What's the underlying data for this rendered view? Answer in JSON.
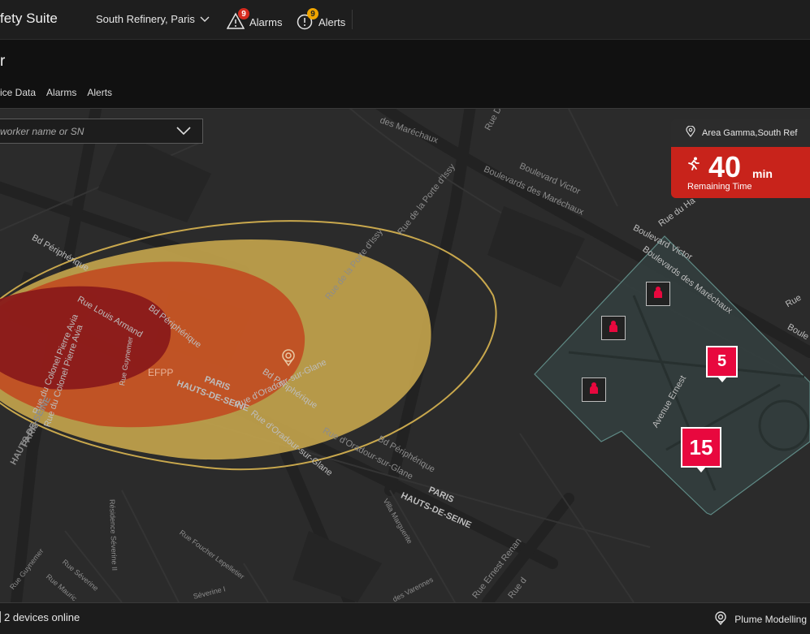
{
  "header": {
    "app_title": "fety Suite",
    "site": "South Refinery, Paris",
    "alarms": {
      "label": "Alarms",
      "count": "9",
      "badge_color": "#d62b1f"
    },
    "alerts": {
      "label": "Alerts",
      "count": "9",
      "badge_color": "#f0a500"
    }
  },
  "subheader": {
    "title": "r",
    "tabs": [
      {
        "label": "ice Data"
      },
      {
        "label": "Alarms"
      },
      {
        "label": "Alerts"
      }
    ]
  },
  "map": {
    "search_placeholder": "worker name or SN",
    "area": {
      "name": "Area Gamma,South Ref",
      "timer_value": "40",
      "timer_unit": "min",
      "timer_label": "Remaining Time",
      "timer_color": "#c8231b"
    },
    "markers": [
      {
        "count": "5"
      },
      {
        "count": "15"
      }
    ],
    "plume_label": "EFPP",
    "streets": [
      "des Maréchaux",
      "Rue Desh",
      "Boulevard Victor",
      "Boulevards des Maréchaux",
      "Rue de la Porte d'Issy",
      "Rue de la Porte d'Issy",
      "Bd Périphérique",
      "Rue Louis Armand",
      "Bd Périphérique",
      "Rue du Colonel Pierre Avia",
      "Rue du Colonel Pierre Avia",
      "Rue Guynemer",
      "PARIS",
      "HAUTS-DE-SEINE",
      "Bd Périphérique",
      "Rue d'Oradour-sur-Glane",
      "Rue d'Oradour-sur-Glane",
      "Bd Périphérique",
      "Rue d'Oradour-sur-Glane",
      "PARIS",
      "HAUTS-DE-SEINE",
      "PARIS",
      "HAUTS-DE-SEINE",
      "Boulevard Victor",
      "Boulevards des Maréchaux",
      "Rue du Ha",
      "Avenue Ernest",
      "Rue",
      "Boule",
      "Villa Marguerite",
      "Résidence Séverine II",
      "Rue Foucher Lepelletier",
      "Rue Guynemer",
      "Rue Séverine",
      "Rue Mauric",
      "Séverine I",
      "Rue Ernest Renan",
      "Rue d",
      "des Varennes"
    ]
  },
  "footer": {
    "devices": "2 devices online",
    "plume_button": "Plume Modelling"
  },
  "colors": {
    "plume_outer": "#c9a84d",
    "plume_mid": "#c2461e",
    "plume_inner": "#8a1a1a",
    "zone": "#34403f",
    "marker": "#e8083e"
  }
}
